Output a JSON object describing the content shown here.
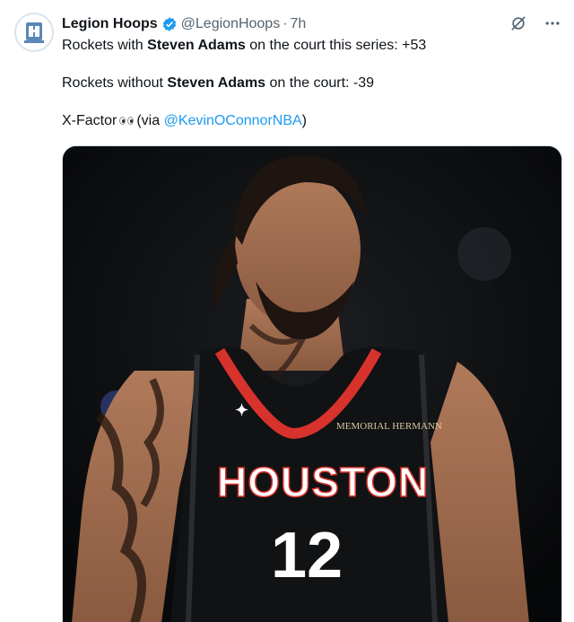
{
  "tweet": {
    "author": {
      "display_name": "Legion Hoops",
      "handle": "@LegionHoops",
      "verified": true,
      "avatar_icon": "legion-hoops-logo"
    },
    "separator": "·",
    "time": "7h",
    "actions": {
      "grok_icon": "grok-slash-icon",
      "more_icon": "more-icon",
      "more_label": "···"
    },
    "text": {
      "line1_prefix": "Rockets with ",
      "line1_bold": "Steven Adams",
      "line1_suffix": " on the court this series: +53",
      "line2_prefix": "Rockets without ",
      "line2_bold": "Steven Adams",
      "line2_suffix": " on the court: -39",
      "line3_prefix": "X-Factor",
      "line3_via": "(via ",
      "line3_mention": "@KevinOConnorNBA",
      "line3_close": ")"
    },
    "media": {
      "alt": "Photo of a Houston Rockets player in a black jersey number 12",
      "jersey_text": "HOUSTON",
      "jersey_number": "12",
      "sponsor_text": "MEMORIAL HERMANN"
    }
  },
  "colors": {
    "text": "#0f1419",
    "secondary": "#536471",
    "link": "#1d9bf0",
    "verified": "#1d9bf0",
    "jersey": "#111214",
    "jersey_trim": "#d8322c"
  }
}
